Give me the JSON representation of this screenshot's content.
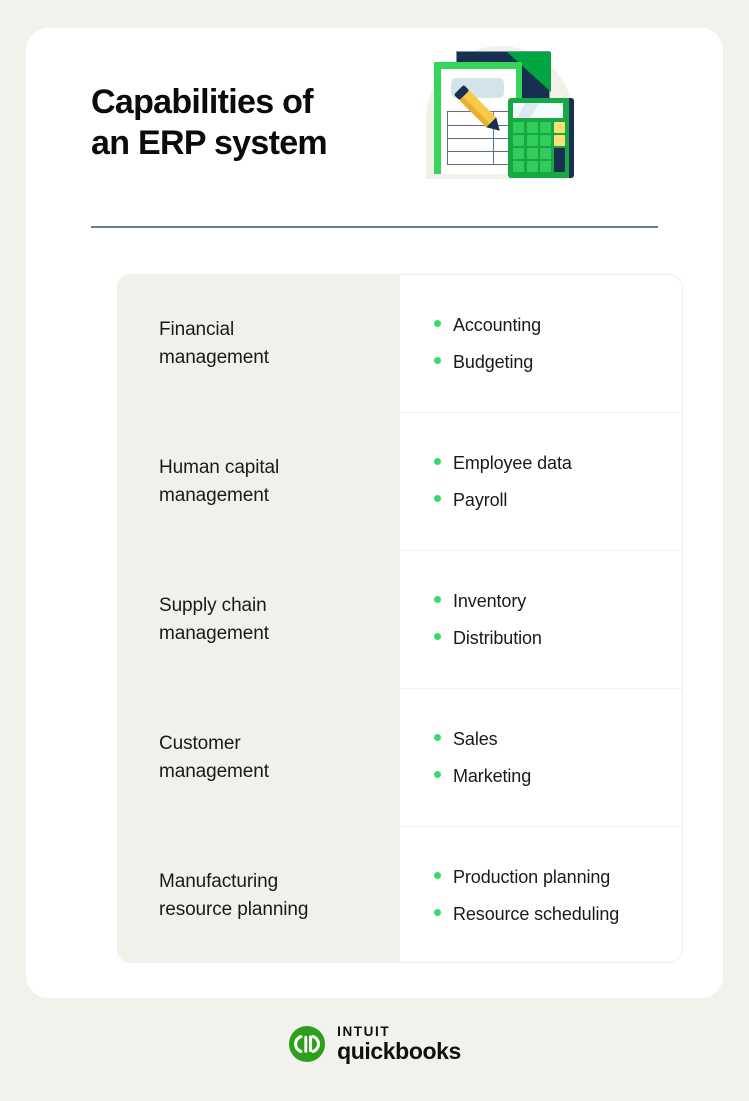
{
  "header": {
    "title_line1": "Capabilities of",
    "title_line2": "an ERP system"
  },
  "illustration": {
    "name": "erp-document-calculator-illustration",
    "parts": [
      "back-document",
      "front-document",
      "pencil",
      "calculator"
    ],
    "colors": {
      "green": "#37d45c",
      "dark_green": "#17a843",
      "navy": "#17304f",
      "yellow": "#f7c948",
      "light_blue": "#d3e5ea",
      "beige_arch": "#f1f1ea"
    }
  },
  "table": {
    "rows": [
      {
        "label_line1": "Financial",
        "label_line2": "management",
        "items": [
          "Accounting",
          "Budgeting"
        ]
      },
      {
        "label_line1": "Human capital",
        "label_line2": "management",
        "items": [
          "Employee data",
          "Payroll"
        ]
      },
      {
        "label_line1": "Supply chain",
        "label_line2": "management",
        "items": [
          "Inventory",
          "Distribution"
        ]
      },
      {
        "label_line1": "Customer",
        "label_line2": "management",
        "items": [
          "Sales",
          "Marketing"
        ]
      },
      {
        "label_line1": "Manufacturing",
        "label_line2": "resource planning",
        "items": [
          "Production planning",
          "Resource scheduling"
        ]
      }
    ]
  },
  "footer": {
    "brand_top": "INTUIT",
    "brand_main": "quickbooks",
    "logo_icon": "quickbooks-qb-circle-icon"
  },
  "theme": {
    "page_background": "#f2f2ec",
    "card_background": "#ffffff",
    "label_cell_background": "#f1f1ec",
    "bullet_green": "#3ad96b",
    "rule_color": "#6b7a8f",
    "text_color": "#1a1a1a",
    "brand_green": "#2ca01c"
  }
}
